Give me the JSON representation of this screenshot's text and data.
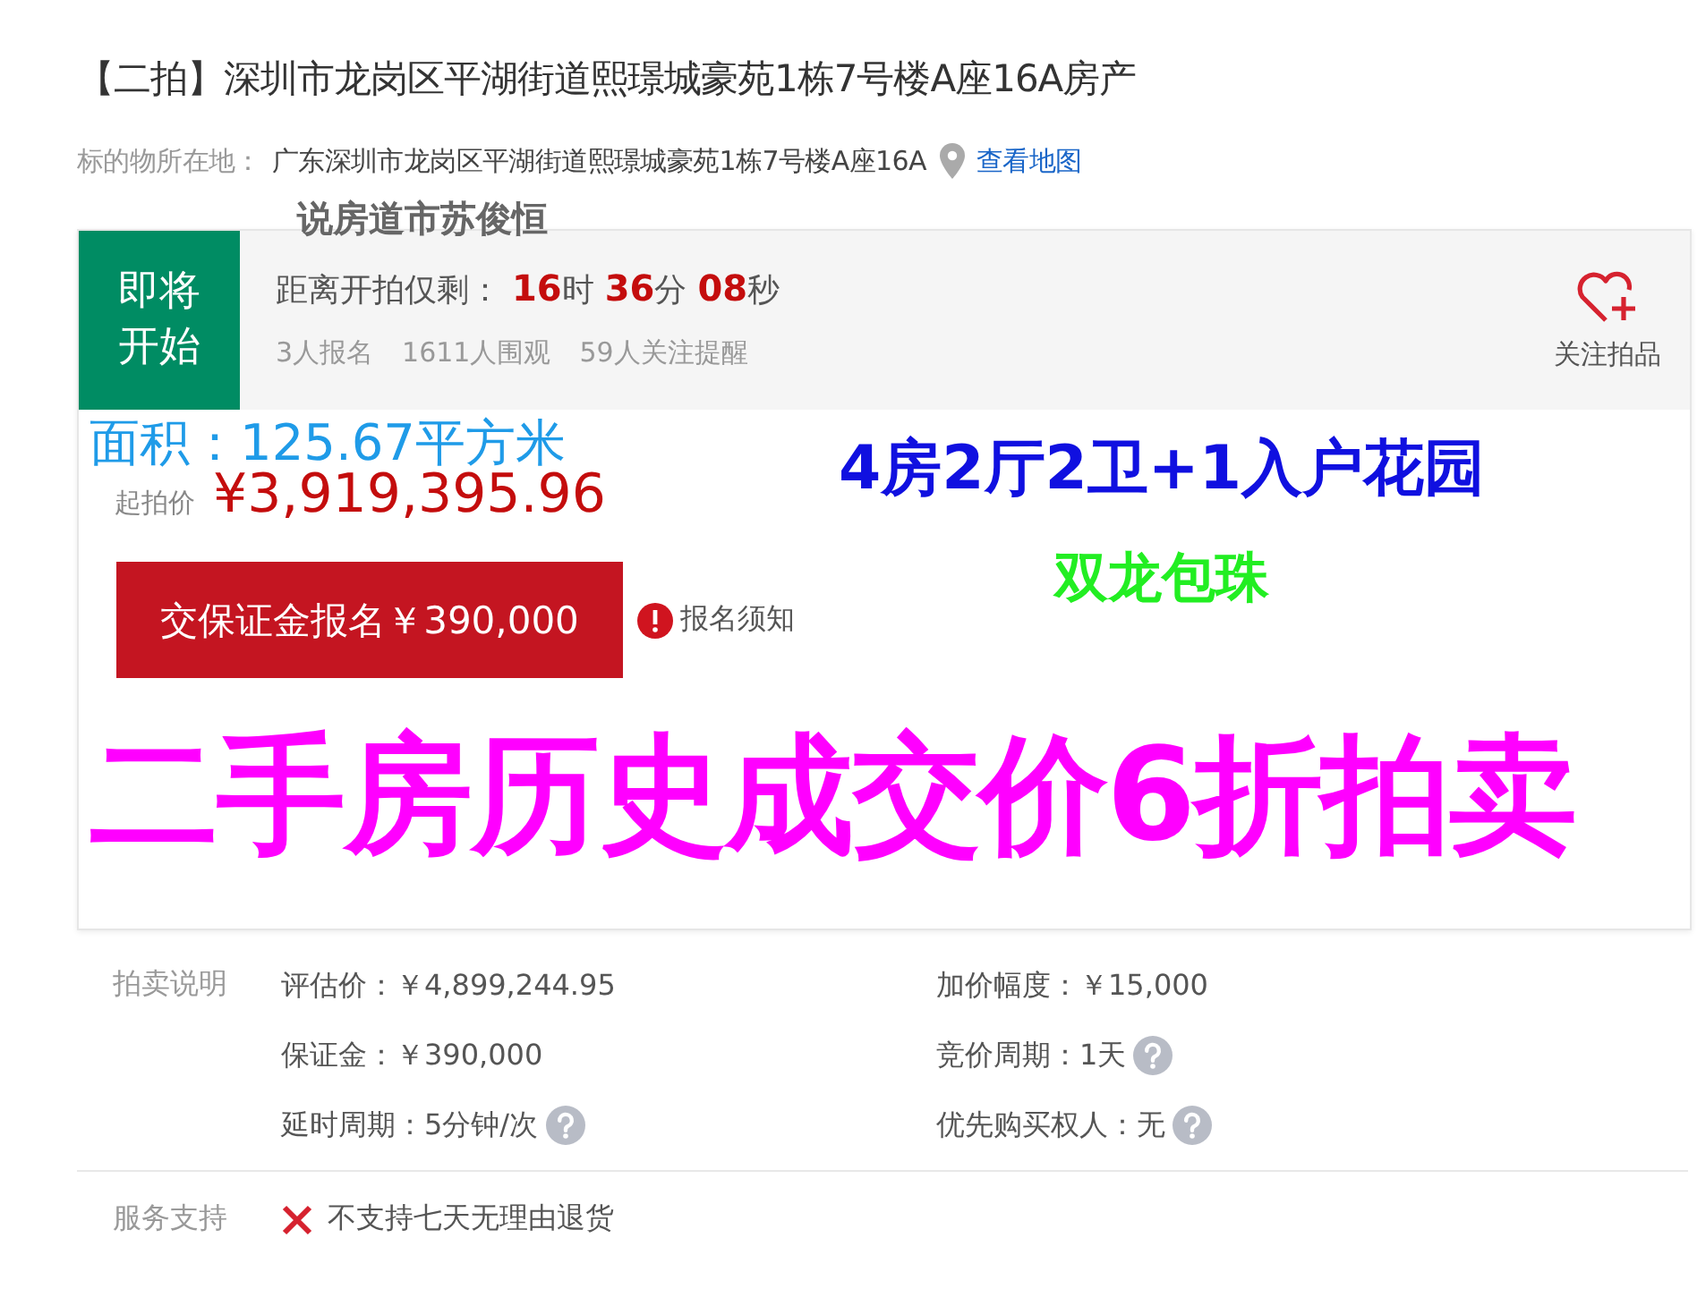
{
  "title": "【二拍】深圳市龙岗区平湖街道熙璟城豪苑1栋7号楼A座16A房产",
  "location": {
    "label": "标的物所在地：",
    "address": "广东深圳市龙岗区平湖街道熙璟城豪苑1栋7号楼A座16A",
    "map_link": "查看地图"
  },
  "overlay_caption": "说房道市苏俊恒",
  "status": {
    "badge": "即将开始",
    "countdown_label": "距离开拍仅剩：",
    "countdown": [
      {
        "value": "16",
        "unit": "时"
      },
      {
        "value": "36",
        "unit": "分"
      },
      {
        "value": "08",
        "unit": "秒"
      }
    ],
    "stats": [
      "3人报名",
      "1611人围观",
      "59人关注提醒"
    ],
    "follow_label": "关注拍品"
  },
  "area": "面积：125.67平方米",
  "start_price": {
    "label": "起拍价",
    "value": "¥3,919,395.96"
  },
  "deposit_button": "交保证金报名￥390,000",
  "notice_link": "报名须知",
  "headline_blue": "4房2厅2卫+1入户花园",
  "headline_green": "双龙包珠",
  "headline_magenta": "二手房历史成交价6折拍卖",
  "auction_info": {
    "label": "拍卖说明",
    "items": [
      {
        "label": "评估价：",
        "value": "￥4,899,244.95",
        "help": false
      },
      {
        "label": "加价幅度：",
        "value": "￥15,000",
        "help": false
      },
      {
        "label": "保证金：",
        "value": "￥390,000",
        "help": false
      },
      {
        "label": "竞价周期：",
        "value": "1天",
        "help": true
      },
      {
        "label": "延时周期：",
        "value": "5分钟/次",
        "help": true
      },
      {
        "label": "优先购买权人：",
        "value": "无",
        "help": true
      }
    ]
  },
  "service": {
    "label": "服务支持",
    "items": [
      {
        "text": "不支持七天无理由退货",
        "supported": false
      }
    ]
  }
}
